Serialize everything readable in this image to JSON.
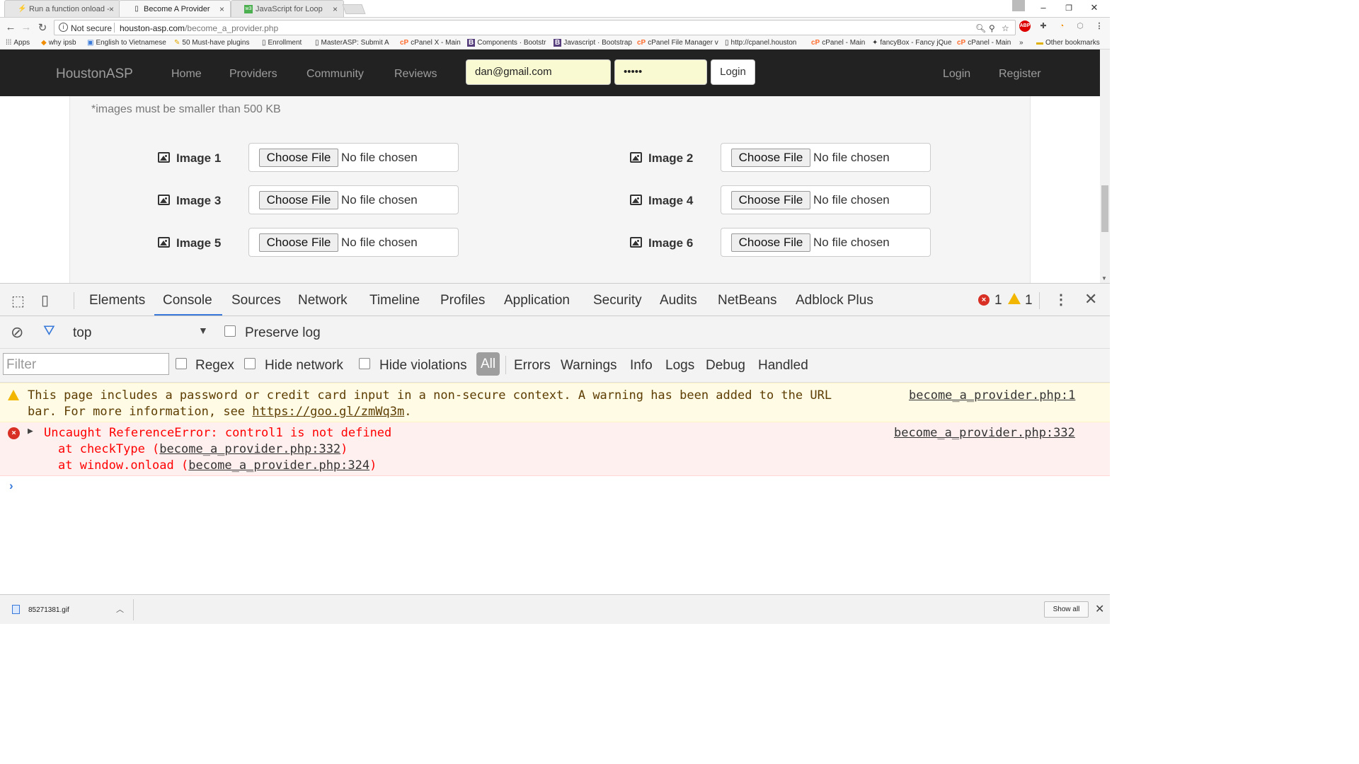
{
  "browser": {
    "tabs": [
      {
        "title": "Run a function onload - ",
        "icon": "stackoverflow-icon",
        "active": false
      },
      {
        "title": "Become A Provider",
        "icon": "page-icon",
        "active": true
      },
      {
        "title": "JavaScript for Loop",
        "icon": "w3schools-icon",
        "active": false
      }
    ],
    "security_text": "Not secure",
    "url_host": "houston-asp.com",
    "url_path": "/become_a_provider.php",
    "bookmarks": [
      {
        "label": "Apps",
        "icon": "apps-grid-icon"
      },
      {
        "label": "why ipsb",
        "icon": "bookmark-icon"
      },
      {
        "label": "English to Vietnamese",
        "icon": "bookmark-icon"
      },
      {
        "label": "50 Must-have plugins",
        "icon": "bookmark-icon"
      },
      {
        "label": "Enrollment",
        "icon": "page-icon"
      },
      {
        "label": "MasterASP: Submit A",
        "icon": "page-icon"
      },
      {
        "label": "cPanel X - Main",
        "icon": "cpanel-icon"
      },
      {
        "label": "Components · Bootstr",
        "icon": "bootstrap-icon"
      },
      {
        "label": "Javascript · Bootstrap",
        "icon": "bootstrap-icon"
      },
      {
        "label": "cPanel File Manager v",
        "icon": "cpanel-icon"
      },
      {
        "label": "http://cpanel.houston",
        "icon": "page-icon"
      },
      {
        "label": "cPanel - Main",
        "icon": "cpanel-icon"
      },
      {
        "label": "fancyBox - Fancy jQue",
        "icon": "bookmark-icon"
      },
      {
        "label": "cPanel - Main",
        "icon": "cpanel-icon"
      }
    ],
    "other_bookmarks": "Other bookmarks",
    "more_bookmarks": "»"
  },
  "site": {
    "brand": "HoustonASP",
    "nav": [
      "Home",
      "Providers",
      "Community",
      "Reviews"
    ],
    "email_value": "dan@gmail.com",
    "password_value": "•••••",
    "login_button": "Login",
    "right_nav": [
      "Login",
      "Register"
    ],
    "note": "*images must be smaller than 500 KB",
    "choose_file_label": "Choose File",
    "no_file_label": "No file chosen",
    "images": [
      "Image 1",
      "Image 2",
      "Image 3",
      "Image 4",
      "Image 5",
      "Image 6"
    ]
  },
  "devtools": {
    "tabs": [
      "Elements",
      "Console",
      "Sources",
      "Network",
      "Timeline",
      "Profiles",
      "Application",
      "Security",
      "Audits",
      "NetBeans",
      "Adblock Plus"
    ],
    "active_tab": "Console",
    "error_count": "1",
    "warning_count": "1",
    "context": "top",
    "preserve_log": "Preserve log",
    "filter_placeholder": "Filter",
    "regex": "Regex",
    "hide_network": "Hide network",
    "hide_violations": "Hide violations",
    "levels": [
      "All",
      "Errors",
      "Warnings",
      "Info",
      "Logs",
      "Debug",
      "Handled"
    ],
    "warning_msg_line1": "This page includes a password or credit card input in a non-secure context. A warning has been added to the URL",
    "warning_msg_line2_prefix": "bar. For more information, see ",
    "warning_msg_link": "https://goo.gl/zmWq3m",
    "warning_msg_line2_suffix": ".",
    "warning_source": "become_a_provider.php:1",
    "error_msg": "Uncaught ReferenceError: control1 is not defined",
    "error_stack1_prefix": "at checkType (",
    "error_stack1_link": "become_a_provider.php:332",
    "error_stack2_prefix": "at window.onload (",
    "error_stack2_link": "become_a_provider.php:324",
    "stack_close": ")",
    "error_source": "become_a_provider.php:332",
    "prompt_symbol": "›"
  },
  "downloads": {
    "file_name": "85271381.gif",
    "show_all": "Show all"
  },
  "colors": {
    "navbar_bg": "#222222",
    "autofill_bg": "#fafad2",
    "devtools_accent": "#3879d9",
    "error_red": "#d93025",
    "warning_yellow": "#f2b600"
  }
}
